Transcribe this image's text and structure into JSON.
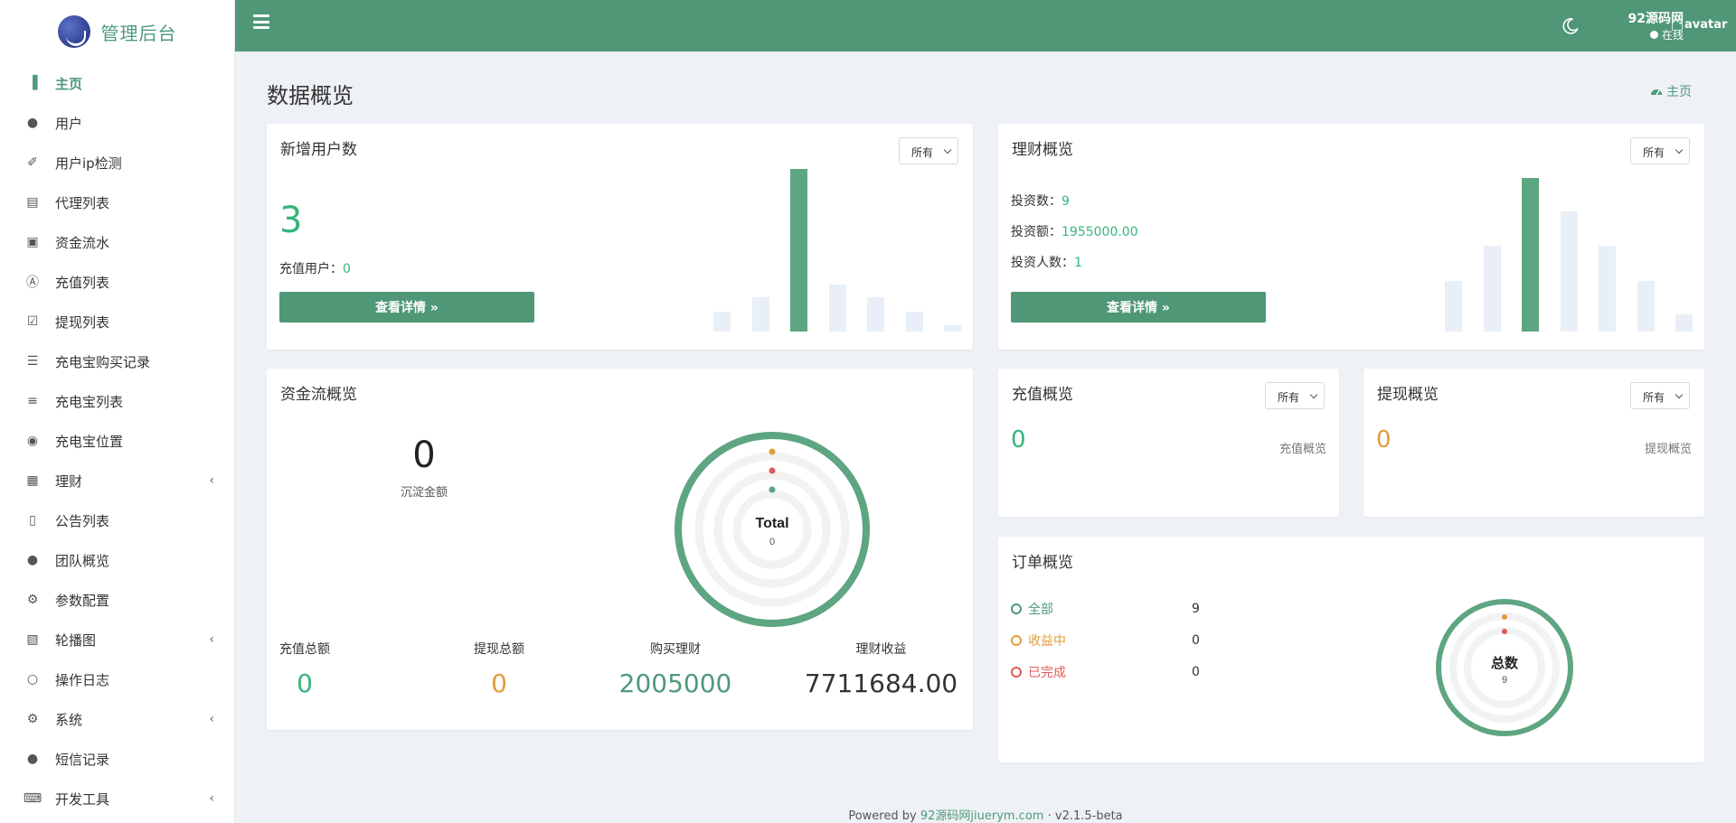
{
  "brand": {
    "name": "管理后台"
  },
  "sidebar": {
    "items": [
      {
        "label": "主页",
        "icon": "bar-chart-icon",
        "active": true
      },
      {
        "label": "用户",
        "icon": "user-icon"
      },
      {
        "label": "用户ip检测",
        "icon": "wrench-icon"
      },
      {
        "label": "代理列表",
        "icon": "address-book-icon"
      },
      {
        "label": "资金流水",
        "icon": "money-icon"
      },
      {
        "label": "充值列表",
        "icon": "font-box-icon"
      },
      {
        "label": "提现列表",
        "icon": "check-square-icon"
      },
      {
        "label": "充电宝购买记录",
        "icon": "list-icon"
      },
      {
        "label": "充电宝列表",
        "icon": "indent-icon"
      },
      {
        "label": "充电宝位置",
        "icon": "map-pin-icon"
      },
      {
        "label": "理财",
        "icon": "archive-icon",
        "caret": true
      },
      {
        "label": "公告列表",
        "icon": "file-icon"
      },
      {
        "label": "团队概览",
        "icon": "users-icon"
      },
      {
        "label": "参数配置",
        "icon": "cogs-icon"
      },
      {
        "label": "轮播图",
        "icon": "image-icon",
        "caret": true
      },
      {
        "label": "操作日志",
        "icon": "circle-icon"
      },
      {
        "label": "系统",
        "icon": "gear-icon",
        "caret": true
      },
      {
        "label": "短信记录",
        "icon": "comment-icon"
      },
      {
        "label": "开发工具",
        "icon": "keyboard-icon",
        "caret": true
      }
    ]
  },
  "header": {
    "user_name": "92源码网",
    "user_status": "在线",
    "avatar_alt": "avatar"
  },
  "page": {
    "title": "数据概览",
    "breadcrumb": "主页"
  },
  "new_users": {
    "title": "新增用户数",
    "filter": "所有",
    "count": "3",
    "recharge_label": "充值用户：",
    "recharge_value": "0",
    "button": "查看详情 »",
    "bars": [
      0.12,
      0.21,
      1.0,
      0.29,
      0.21,
      0.12,
      0.04
    ]
  },
  "finance": {
    "title": "理财概览",
    "filter": "所有",
    "invest_count_label": "投资数：",
    "invest_count": "9",
    "invest_amount_label": "投资额：",
    "invest_amount": "1955000.00",
    "investors_label": "投资人数：",
    "investors": "1",
    "button": "查看详情 »",
    "bars": [
      0.33,
      0.56,
      1.0,
      0.78,
      0.56,
      0.33,
      0.11
    ]
  },
  "funds": {
    "title": "资金流概览",
    "sediment_value": "0",
    "sediment_label": "沉淀金额",
    "donut_title": "Total",
    "donut_value": "0",
    "stats": [
      {
        "label": "充值总额",
        "value": "0",
        "color": "#34b67a"
      },
      {
        "label": "提现总额",
        "value": "0",
        "color": "#e39b3b"
      },
      {
        "label": "购买理财",
        "value": "2005000",
        "color": "#4e9a7a"
      },
      {
        "label": "理财收益",
        "value": "7711684.00",
        "color": "#333333"
      }
    ]
  },
  "recharge": {
    "title": "充值概览",
    "filter": "所有",
    "value": "0",
    "caption": "充值概览"
  },
  "withdraw": {
    "title": "提现概览",
    "filter": "所有",
    "value": "0",
    "caption": "提现概览"
  },
  "orders": {
    "title": "订单概览",
    "legend": [
      {
        "label": "全部",
        "value": "9",
        "color": "#4e9a7a"
      },
      {
        "label": "收益中",
        "value": "0",
        "color": "#e39b3b"
      },
      {
        "label": "已完成",
        "value": "0",
        "color": "#e05a5a"
      }
    ],
    "donut_title": "总数",
    "donut_value": "9"
  },
  "footer": {
    "prefix": "Powered by",
    "link": "92源码网jiuerym.com",
    "sep": "·",
    "version": "v2.1.5-beta"
  },
  "colors": {
    "accent": "#4f9777",
    "green_value": "#34b67a",
    "orange_value": "#e39b3b",
    "red_value": "#e05a5a"
  }
}
